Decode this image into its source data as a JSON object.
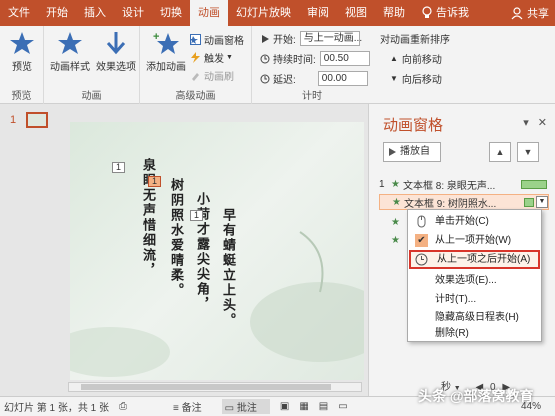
{
  "tabs": [
    "文件",
    "开始",
    "插入",
    "设计",
    "切换",
    "动画",
    "幻灯片放映",
    "审阅",
    "视图",
    "帮助"
  ],
  "active_tab": "动画",
  "tell_me": "告诉我",
  "share": "共享",
  "ribbon": {
    "preview_label": "预览",
    "preview_group": "预览",
    "anim_style": "动画样式",
    "effect_options": "效果选项",
    "anim_group": "动画",
    "add_anim": "添加动画",
    "anim_pane_btn": "动画窗格",
    "trigger": "触发",
    "anim_brush": "动画刷",
    "adv_group": "高级动画",
    "start_label": "开始:",
    "start_value": "与上一动画...",
    "duration_label": "持续时间:",
    "duration_value": "00.50",
    "delay_label": "延迟:",
    "delay_value": "00.00",
    "timing_group": "计时",
    "reorder": "对动画重新排序",
    "move_earlier": "向前移动",
    "move_later": "向后移动"
  },
  "slide": {
    "thumb_num": "1",
    "poem_col1": "泉眼无声惜细流，",
    "poem_col2": "树阴照水爱晴柔。",
    "poem_col3": "小荷才露尖尖角，",
    "poem_col4": "早有蜻蜓立上头。",
    "tag1": "1",
    "tag2": "1",
    "tag3": "1"
  },
  "pane": {
    "title": "动画窗格",
    "play": "播放自",
    "item1_num": "1",
    "item1_label": "文本框 8: 泉眼无声...",
    "item2_label": "文本框 9: 树阴照水..."
  },
  "menu": {
    "items": [
      "单击开始(C)",
      "从上一项开始(W)",
      "从上一项之后开始(A)",
      "效果选项(E)...",
      "计时(T)...",
      "隐藏高级日程表(H)",
      "删除(R)"
    ]
  },
  "pane_bottom": {
    "seconds": "秒",
    "zoom_val": "0"
  },
  "status": {
    "slide_info": "幻灯片 第 1 张，共 1 张",
    "notes": "备注",
    "comments": "批注",
    "zoom": "44%"
  },
  "watermark": "头条 @部落窝教育"
}
